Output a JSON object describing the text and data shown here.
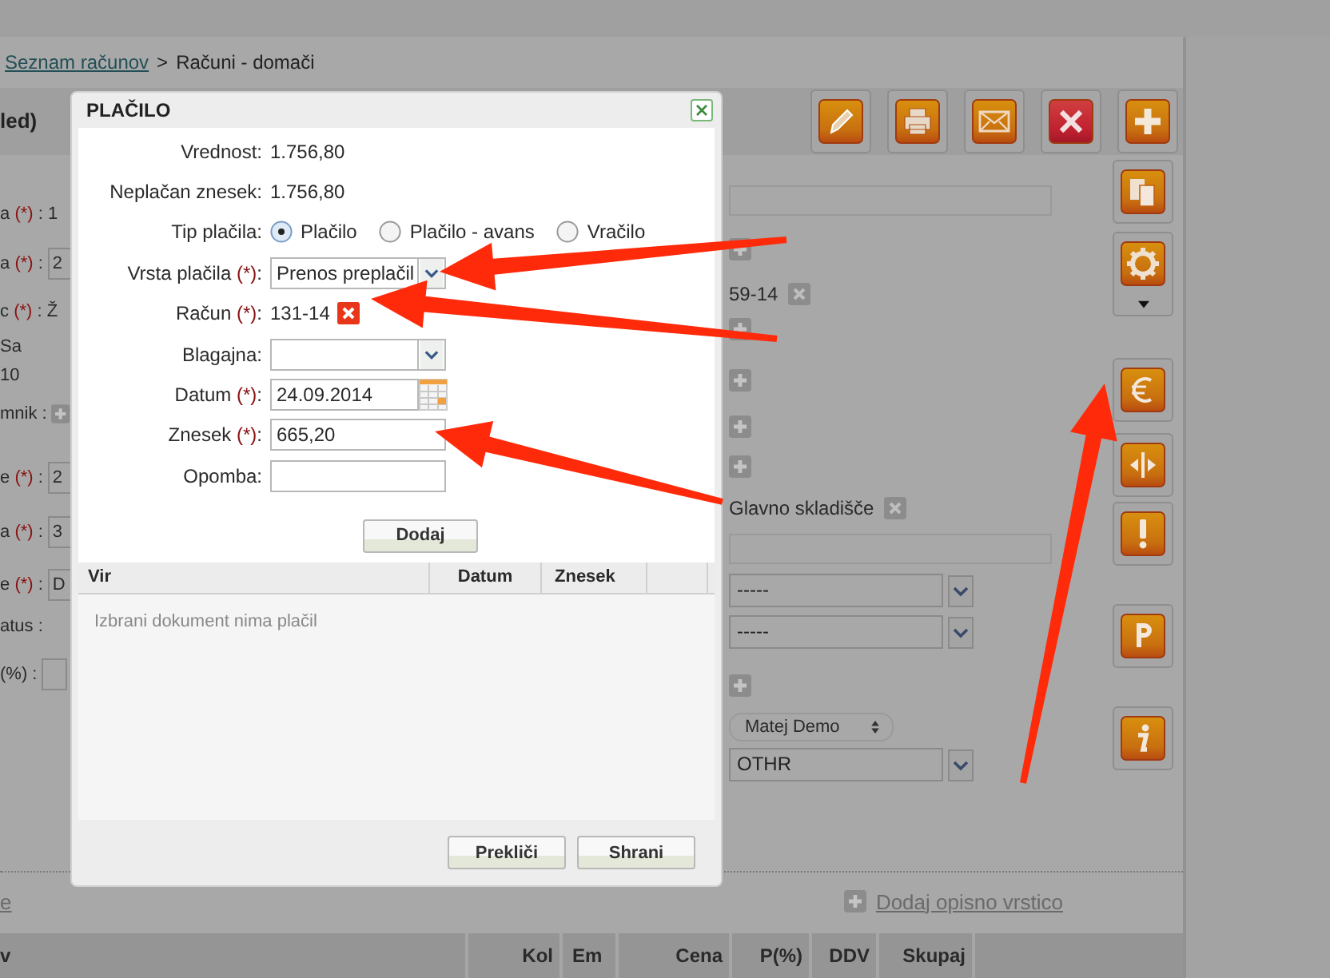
{
  "breadcrumb": {
    "link": "Seznam računov",
    "separator": ">",
    "current": "Računi - domači"
  },
  "band_title": "led)",
  "left_rows": [
    {
      "kind": "text",
      "label": "a",
      "mark": "(*)",
      "value": ": 1"
    },
    {
      "kind": "field",
      "label": "a",
      "mark": "(*)",
      "sep": ":",
      "value": "2"
    },
    {
      "kind": "text",
      "label": "c",
      "mark": "(*)",
      "value": ": Ž"
    },
    {
      "kind": "text",
      "label": "Sa"
    },
    {
      "kind": "text",
      "label": "10"
    },
    {
      "kind": "add",
      "label": "mnik :"
    },
    {
      "kind": "field",
      "label": "e",
      "mark": "(*)",
      "sep": ":",
      "value": "2"
    },
    {
      "kind": "field",
      "label": "a",
      "mark": "(*)",
      "sep": ":",
      "value": "3"
    },
    {
      "kind": "field",
      "label": "e",
      "mark": "(*)",
      "sep": ":",
      "value": "D"
    },
    {
      "kind": "text",
      "label": "atus :"
    },
    {
      "kind": "field",
      "label": "(%) :"
    }
  ],
  "right_rows": [
    {
      "kind": "field"
    },
    {
      "kind": "add"
    },
    {
      "kind": "tag",
      "value": "59-14"
    },
    {
      "kind": "add"
    },
    {
      "kind": "add"
    },
    {
      "kind": "add"
    },
    {
      "kind": "add"
    },
    {
      "kind": "tag",
      "value": "Glavno skladišče"
    },
    {
      "kind": "field"
    },
    {
      "kind": "select",
      "value": "-----"
    },
    {
      "kind": "select",
      "value": "-----"
    },
    {
      "kind": "add"
    },
    {
      "kind": "popup",
      "value": "Matej Demo"
    },
    {
      "kind": "select",
      "value": "OTHR"
    }
  ],
  "dialog": {
    "title": "PLAČILO",
    "rows": [
      {
        "kind": "value",
        "label": "Vrednost:",
        "value": "1.756,80"
      },
      {
        "kind": "value",
        "label": "Neplačan znesek:",
        "value": "1.756,80"
      },
      {
        "kind": "radio",
        "label": "Tip plačila:",
        "options": [
          {
            "label": "Plačilo",
            "selected": true
          },
          {
            "label": "Plačilo - avans",
            "selected": false
          },
          {
            "label": "Vračilo",
            "selected": false
          }
        ]
      },
      {
        "kind": "select",
        "label": "Vrsta plačila",
        "mark": "(*)",
        "sep": ":",
        "value": "Prenos preplačil"
      },
      {
        "kind": "tag",
        "label": "Račun",
        "mark": "(*)",
        "sep": ":",
        "value": "131-14"
      },
      {
        "kind": "select",
        "label": "Blagajna:"
      },
      {
        "kind": "date",
        "label": "Datum",
        "mark": "(*)",
        "sep": ":",
        "value": "24.09.2014"
      },
      {
        "kind": "input",
        "label": "Znesek",
        "mark": "(*)",
        "sep": ":",
        "value": "665,20"
      },
      {
        "kind": "input",
        "label": "Opomba:"
      }
    ],
    "add_button": "Dodaj",
    "table": {
      "columns": [
        "Vir",
        "Datum",
        "Znesek"
      ],
      "empty_message": "Izbrani dokument nima plačil"
    },
    "buttons": [
      "Prekliči",
      "Shrani"
    ]
  },
  "bottom_left_link": "e",
  "add_line_link": "Dodaj opisno vrstico",
  "items_table": {
    "columns": [
      "v",
      "Kol",
      "Em",
      "Cena",
      "P(%)",
      "DDV",
      "Skupaj"
    ]
  }
}
